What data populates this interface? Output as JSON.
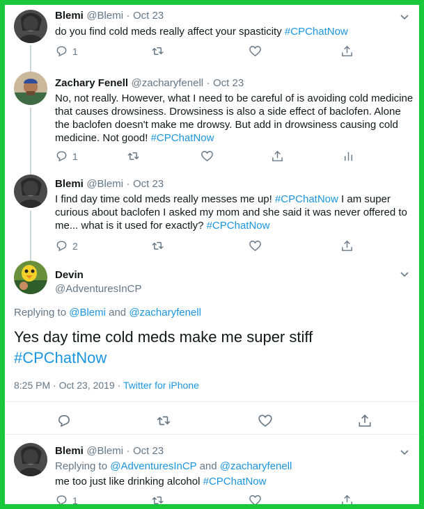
{
  "tweets": [
    {
      "name": "Blemi",
      "handle": "@Blemi",
      "sep": "·",
      "date": "Oct 23",
      "text": "do you find cold meds really affect your spasticity ",
      "hashtag": "#CPChatNow",
      "reply_count": "1"
    },
    {
      "name": "Zachary Fenell",
      "handle": "@zacharyfenell",
      "sep": "·",
      "date": "Oct 23",
      "text": "No, not really. However, what I need to be careful of is avoiding cold medicine that causes drowsiness. Drowsiness is also a side effect of baclofen. Alone the baclofen doesn't make me drowsy. But add in drowsiness causing cold medicine. Not good! ",
      "hashtag": "#CPChatNow",
      "reply_count": "1"
    },
    {
      "name": "Blemi",
      "handle": "@Blemi",
      "sep": "·",
      "date": "Oct 23",
      "text_a": "I find day time cold meds really messes me up! ",
      "hashtag_a": "#CPChatNow",
      "text_b": " I am super curious about baclofen I asked my mom and she said it was never offered to me... what is it used for exactly? ",
      "hashtag_b": "#CPChatNow",
      "reply_count": "2"
    }
  ],
  "focused": {
    "name": "Devin",
    "handle": "@AdventuresInCP",
    "replying_prefix": "Replying to ",
    "replying_user1": "@Blemi",
    "replying_and": " and ",
    "replying_user2": "@zacharyfenell",
    "text": "Yes day time cold meds make me super stiff",
    "hashtag": "#CPChatNow",
    "timestamp": "8:25 PM · Oct 23, 2019",
    "sep": " · ",
    "source": "Twitter for iPhone"
  },
  "last_reply": {
    "name": "Blemi",
    "handle": "@Blemi",
    "sep": "·",
    "date": "Oct 23",
    "replying_prefix": "Replying to ",
    "replying_user1": "@AdventuresInCP",
    "replying_and": " and ",
    "replying_user2": "@zacharyfenell",
    "text": "me too just like drinking alcohol ",
    "hashtag": "#CPChatNow",
    "reply_count": "1"
  },
  "colors": {
    "frame": "#19c73a",
    "link": "#1b95e0",
    "muted": "#657786"
  }
}
